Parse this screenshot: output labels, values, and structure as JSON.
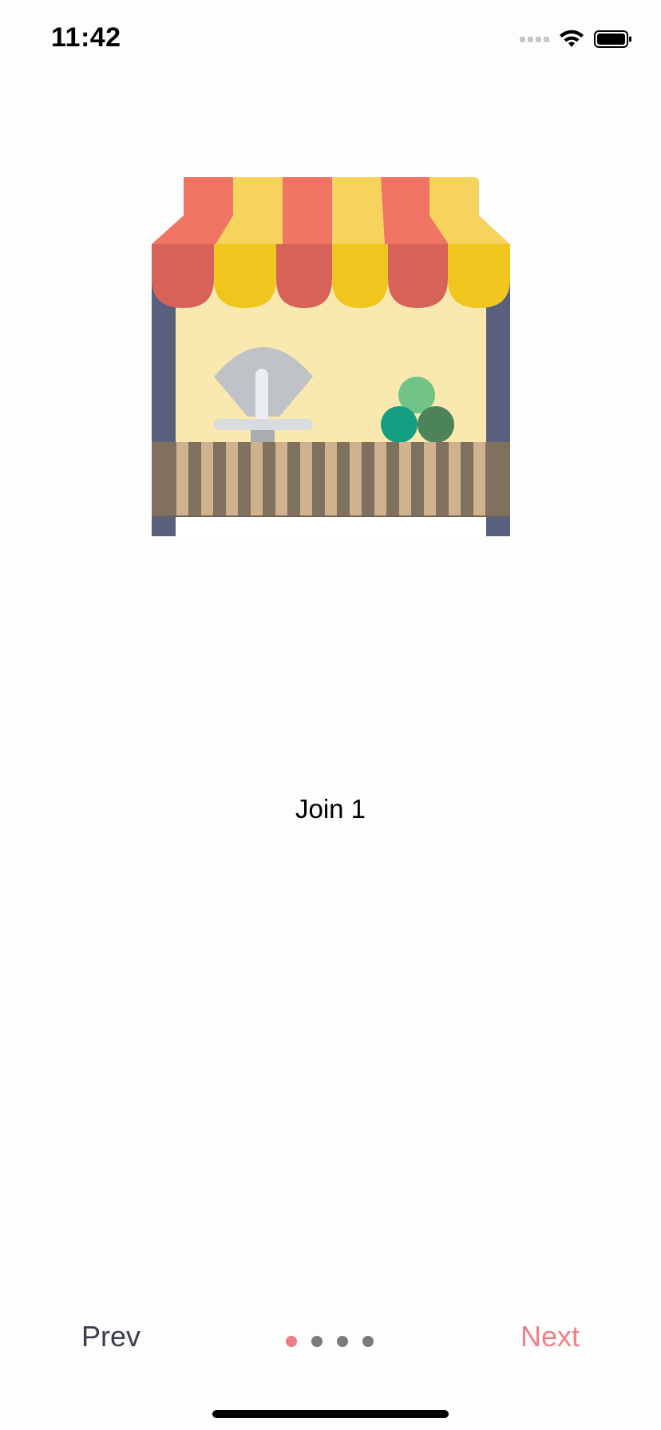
{
  "status_bar": {
    "time": "11:42",
    "icons": [
      "signal-icon",
      "wifi-icon",
      "battery-icon"
    ]
  },
  "illustration": {
    "name": "market-stall-icon",
    "colors": {
      "awning_red": "#ef7463",
      "awning_red_dark": "#d6625a",
      "awning_yellow": "#f5d35c",
      "awning_yellow_dark": "#f0c51d",
      "wall": "#f9e9af",
      "posts": "#58607e",
      "counter": "#80705e",
      "counter_light": "#d0b28f"
    }
  },
  "content": {
    "title": "Join 1"
  },
  "navigation": {
    "prev_label": "Prev",
    "next_label": "Next",
    "page_count": 4,
    "current_page": 1,
    "colors": {
      "next": "#f08088",
      "prev": "#3a3f4d",
      "dot_active": "#f07c85",
      "dot_inactive": "#7b7b7b"
    }
  }
}
